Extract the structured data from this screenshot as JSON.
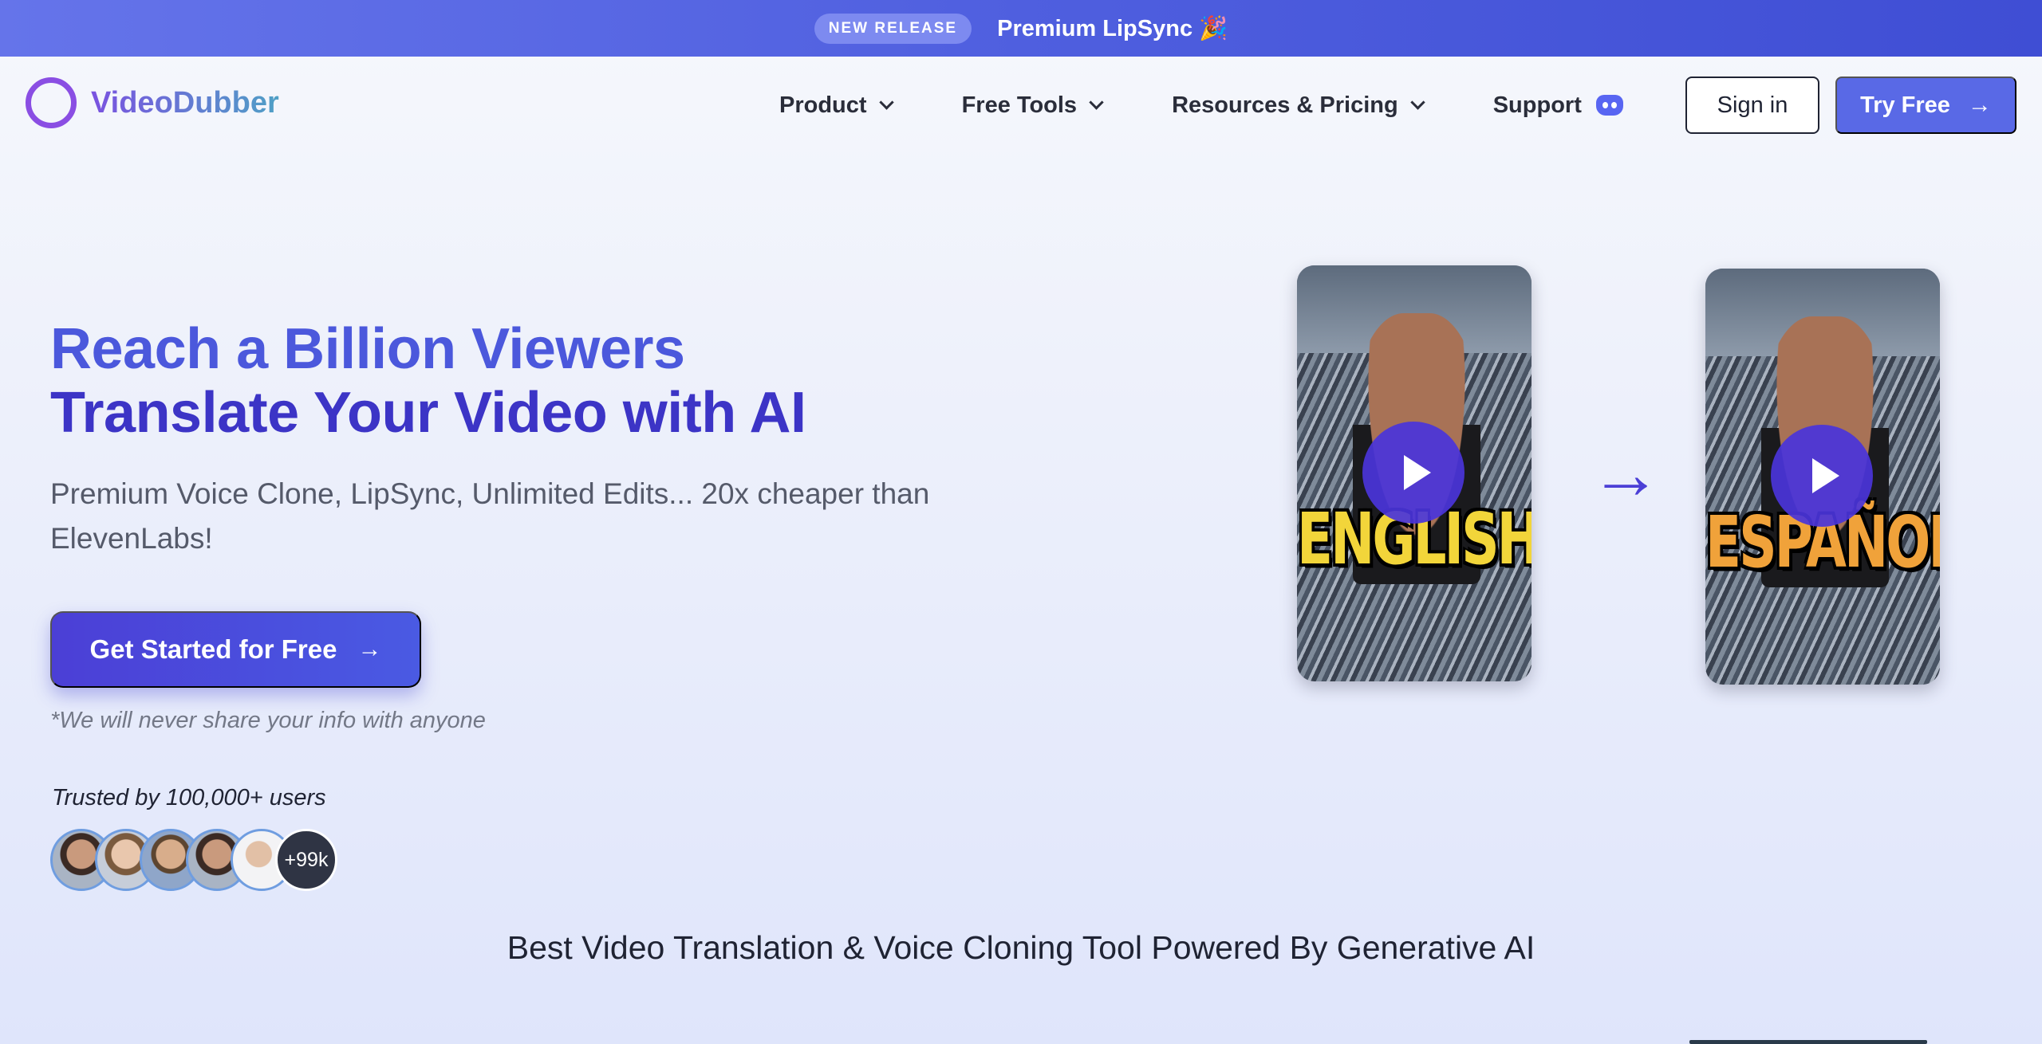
{
  "announcement": {
    "badge": "NEW RELEASE",
    "text": "Premium LipSync 🎉"
  },
  "header": {
    "logo_text": "VideoDubber",
    "nav": [
      {
        "label": "Product",
        "has_dropdown": true
      },
      {
        "label": "Free Tools",
        "has_dropdown": true
      },
      {
        "label": "Resources & Pricing",
        "has_dropdown": true
      },
      {
        "label": "Support",
        "icon": "discord-icon"
      }
    ],
    "sign_in": "Sign in",
    "try_free": "Try Free"
  },
  "hero": {
    "title_line1": "Reach a Billion Viewers",
    "title_line2": "Translate Your Video with AI",
    "subtitle": "Premium Voice Clone, LipSync, Unlimited Edits... 20x cheaper than ElevenLabs!",
    "cta": "Get Started for Free",
    "note": "*We will never share your info with anyone",
    "trusted": "Trusted by 100,000+ users",
    "avatar_more": "+99k"
  },
  "videos": [
    {
      "caption": "ENGLISH"
    },
    {
      "caption": "ESPAÑOL"
    }
  ],
  "tagline": "Best Video Translation & Voice Cloning Tool Powered By Generative AI",
  "colors": {
    "brand_primary": "#4b3fd6",
    "announce_bg": "#5465e2",
    "try_free_bg": "#5969e6",
    "logo_ring": "#8a4ee3"
  }
}
